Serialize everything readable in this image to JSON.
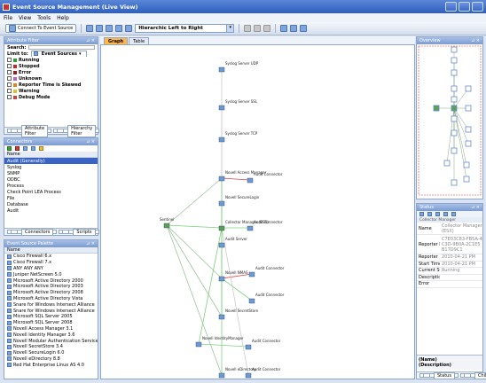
{
  "window": {
    "title": "Event Source Management (Live View)"
  },
  "menu": [
    "File",
    "View",
    "Tools",
    "Help"
  ],
  "toolbar": {
    "connect_label": "Connect To Event Source",
    "layout_value": "Hierarchic Left to Right"
  },
  "attribute_filter": {
    "title": "Attribute Filter",
    "search_label": "Search:",
    "limit_label": "Limit to:",
    "limit_value": "Event Sources",
    "items": [
      {
        "label": "Running",
        "color": "#2e9e2e"
      },
      {
        "label": "Stopped",
        "color": "#d02020"
      },
      {
        "label": "Error",
        "color": "#9a2020"
      },
      {
        "label": "Unknown",
        "color": "#c060d0"
      },
      {
        "label": "Reporter Time is Skewed",
        "color": "#e08020"
      },
      {
        "label": "Warning",
        "color": "#e0c020"
      },
      {
        "label": "Debug Mode",
        "color": "#d04040"
      }
    ],
    "tabs": [
      "Attribute Filter",
      "Hierarchy Filter"
    ]
  },
  "connectors": {
    "title": "Connectors",
    "column": "Name",
    "items": [
      "Audit (Generally)",
      "Syslog",
      "SNMP",
      "ODBC",
      "Process",
      "Check Point LEA Process",
      "File",
      "Database",
      "Audit"
    ],
    "tabs": [
      "Connectors",
      "Scripts"
    ]
  },
  "palette": {
    "title": "Event Source Palette",
    "column": "Name",
    "items": [
      "Cisco Firewall 6.x",
      "Cisco Firewall 7.x",
      "ANY ANY ANY",
      "Juniper NetScreen 5.0",
      "Microsoft Active Directory 2000",
      "Microsoft Active Directory 2003",
      "Microsoft Active Directory 2008",
      "Microsoft Active Directory Vista",
      "Snare for Windows Intersect Alliance",
      "Snare for Windows Intersect Alliance",
      "Microsoft SQL Server 2005",
      "Microsoft SQL Server 2008",
      "Novell Access Manager 3.1",
      "Novell Identity Manager 3.6",
      "Novell Modular Authentication Service",
      "Novell SecretStore 3.4",
      "Novell SecureLogin 6.0",
      "Novell eDirectory 8.8",
      "Red Hat Enterprise Linux AS 4.0"
    ]
  },
  "graph": {
    "tabs": [
      "Graph",
      "Table"
    ],
    "nodes": [
      {
        "label": "Syslog Server UDP"
      },
      {
        "label": "Syslog Server SSL"
      },
      {
        "label": "Syslog Server TCP"
      },
      {
        "label": "Novell Access Manager"
      },
      {
        "label": "Audit Connector"
      },
      {
        "label": "Novell SecureLogin"
      },
      {
        "label": "Sentinel"
      },
      {
        "label": "Collector Manager (ESX)"
      },
      {
        "label": "Audit Connector"
      },
      {
        "label": "Audit Server"
      },
      {
        "label": "Audit Connector"
      },
      {
        "label": "Novell NMAS"
      },
      {
        "label": "Audit Connector"
      },
      {
        "label": "Novell SecretStore"
      },
      {
        "label": "Novell IdentityManager"
      },
      {
        "label": "Audit Connector"
      },
      {
        "label": "Audit Connector"
      },
      {
        "label": "Novell eDirectory"
      }
    ]
  },
  "overview": {
    "title": "Overview"
  },
  "status": {
    "title": "Status",
    "group": "Collector Manager",
    "rows": [
      {
        "key": "Name",
        "value": "Collector Manager (ESX)"
      },
      {
        "key": "Reporter Id",
        "value": "C7E03C83-FB5A-4C3D-9B0A-2C1E5B17D9C1"
      },
      {
        "key": "Reporter",
        "value": "2010-04-21 PM"
      },
      {
        "key": "Start Time",
        "value": "2010-04-21 PM"
      },
      {
        "key": "Current State",
        "value": "Running"
      },
      {
        "key": "Description",
        "value": ""
      },
      {
        "key": "Error",
        "value": ""
      }
    ],
    "footer_name": "(Name)",
    "footer_desc": "(Description)",
    "tabs": [
      "Status",
      "Children"
    ]
  }
}
